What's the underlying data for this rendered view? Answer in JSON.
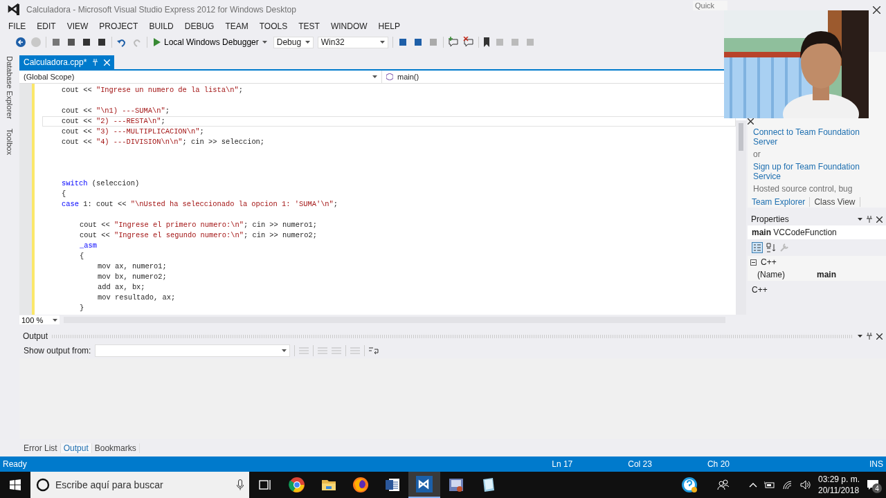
{
  "window": {
    "title": "Calculadora - Microsoft Visual Studio Express 2012 for Windows Desktop",
    "quick_launch": {
      "placeholder": "Quick"
    }
  },
  "menu": [
    "FILE",
    "EDIT",
    "VIEW",
    "PROJECT",
    "BUILD",
    "DEBUG",
    "TEAM",
    "TOOLS",
    "TEST",
    "WINDOW",
    "HELP"
  ],
  "toolbar": {
    "debugger": "Local Windows Debugger",
    "configuration": "Debug",
    "platform": "Win32"
  },
  "side_tabs": [
    "Database Explorer",
    "Toolbox"
  ],
  "document_tabs": [
    {
      "label": "Calculadora.cpp*",
      "selected": true
    }
  ],
  "navigation": {
    "scope": "(Global Scope)",
    "member": "main()"
  },
  "editor": {
    "zoom": "100 %",
    "lines": [
      {
        "kind": "code",
        "current": false,
        "tokens": [
          {
            "kind": "plain",
            "s": "cout << "
          },
          {
            "kind": "string",
            "s": "\"Ingrese un numero de la lista\\n\""
          },
          {
            "kind": "plain",
            "s": ";"
          }
        ]
      },
      {
        "kind": "blank"
      },
      {
        "kind": "code",
        "current": false,
        "tokens": [
          {
            "kind": "plain",
            "s": "cout << "
          },
          {
            "kind": "string",
            "s": "\"\\n1) ---SUMA\\n\""
          },
          {
            "kind": "plain",
            "s": ";"
          }
        ]
      },
      {
        "kind": "code",
        "current": true,
        "tokens": [
          {
            "kind": "plain",
            "s": "cout << "
          },
          {
            "kind": "string",
            "s": "\"2) ---RESTA\\n\""
          },
          {
            "kind": "plain",
            "s": ";"
          }
        ]
      },
      {
        "kind": "code",
        "current": false,
        "tokens": [
          {
            "kind": "plain",
            "s": "cout << "
          },
          {
            "kind": "string",
            "s": "\"3) ---MULTIPLICACION\\n\""
          },
          {
            "kind": "plain",
            "s": ";"
          }
        ]
      },
      {
        "kind": "code",
        "current": false,
        "tokens": [
          {
            "kind": "plain",
            "s": "cout << "
          },
          {
            "kind": "string",
            "s": "\"4) ---DIVISION\\n\\n\""
          },
          {
            "kind": "plain",
            "s": "; cin >> seleccion;"
          }
        ]
      },
      {
        "kind": "blank"
      },
      {
        "kind": "blank"
      },
      {
        "kind": "blank"
      },
      {
        "kind": "code",
        "current": false,
        "tokens": [
          {
            "kind": "keyword",
            "s": "switch"
          },
          {
            "kind": "plain",
            "s": " (seleccion)"
          }
        ]
      },
      {
        "kind": "code",
        "current": false,
        "tokens": [
          {
            "kind": "plain",
            "s": "{"
          }
        ]
      },
      {
        "kind": "code",
        "current": false,
        "tokens": [
          {
            "kind": "keyword",
            "s": "case"
          },
          {
            "kind": "plain",
            "s": " 1: cout << "
          },
          {
            "kind": "string",
            "s": "\"\\nUsted ha seleccionado la opcion 1: 'SUMA'\\n\""
          },
          {
            "kind": "plain",
            "s": ";"
          }
        ],
        "children": [
          {
            "kind": "blank"
          },
          {
            "kind": "code",
            "current": false,
            "tokens": [
              {
                "kind": "plain",
                "s": "cout << "
              },
              {
                "kind": "string",
                "s": "\"Ingrese el primero numero:\\n\""
              },
              {
                "kind": "plain",
                "s": "; cin >> numero1;"
              }
            ]
          },
          {
            "kind": "code",
            "current": false,
            "tokens": [
              {
                "kind": "plain",
                "s": "cout << "
              },
              {
                "kind": "string",
                "s": "\"Ingrese el segundo numero:\\n\""
              },
              {
                "kind": "plain",
                "s": "; cin >> numero2;"
              }
            ]
          },
          {
            "kind": "code",
            "current": false,
            "tokens": [
              {
                "kind": "keyword",
                "s": "_asm"
              }
            ]
          },
          {
            "kind": "code",
            "current": false,
            "tokens": [
              {
                "kind": "plain",
                "s": "{"
              }
            ],
            "children": [
              {
                "kind": "code",
                "current": false,
                "tokens": [
                  {
                    "kind": "plain",
                    "s": "mov ax, numero1;"
                  }
                ]
              },
              {
                "kind": "code",
                "current": false,
                "tokens": [
                  {
                    "kind": "plain",
                    "s": "mov bx, numero2;"
                  }
                ]
              },
              {
                "kind": "code",
                "current": false,
                "tokens": [
                  {
                    "kind": "plain",
                    "s": "add ax, bx;"
                  }
                ]
              },
              {
                "kind": "code",
                "current": false,
                "tokens": [
                  {
                    "kind": "plain",
                    "s": "mov resultado, ax;"
                  }
                ]
              }
            ]
          },
          {
            "kind": "code",
            "current": false,
            "tokens": [
              {
                "kind": "plain",
                "s": "}"
              }
            ]
          }
        ]
      }
    ]
  },
  "team_explorer": {
    "items": [
      {
        "kind": "link",
        "text": "Connect to Team Foundation Server"
      },
      {
        "kind": "text",
        "text": "or"
      },
      {
        "kind": "link",
        "text": "Sign up for Team Foundation Service"
      },
      {
        "kind": "text",
        "text": "Hosted source control, bug"
      }
    ],
    "tabs": [
      {
        "label": "Team Explorer",
        "selected": true
      },
      {
        "label": "Class View",
        "selected": false
      }
    ]
  },
  "properties": {
    "title": "Properties",
    "object": "**main** VCCodeFunction",
    "category": {
      "label": "C++",
      "expanded": true
    },
    "rows": [
      {
        "name": "(Name)",
        "value": "main"
      }
    ],
    "description": "C++"
  },
  "output": {
    "title": "Output",
    "source_label": "Show output from:"
  },
  "bottom_tabs": [
    {
      "label": "Error List",
      "selected": false
    },
    {
      "label": "Output",
      "selected": true
    },
    {
      "label": "Bookmarks",
      "selected": false
    }
  ],
  "status_bar": {
    "state": "Ready",
    "line": "Ln 17",
    "column": "Col 23",
    "char": "Ch 20",
    "mode": "INS"
  },
  "taskbar": {
    "search": {
      "placeholder": "Escribe aquí para buscar"
    },
    "apps": [
      {
        "kind": "chrome",
        "active": false
      },
      {
        "kind": "folder",
        "active": false
      },
      {
        "kind": "firefox",
        "active": false
      },
      {
        "kind": "word",
        "active": false
      },
      {
        "kind": "vs",
        "active": true
      },
      {
        "kind": "media",
        "active": false
      },
      {
        "kind": "notes",
        "active": false
      }
    ],
    "clock": {
      "time": "03:29 p. m.",
      "date": "20/11/2018"
    },
    "notifications": "4"
  },
  "webcam": {
    "kind": "picture"
  }
}
